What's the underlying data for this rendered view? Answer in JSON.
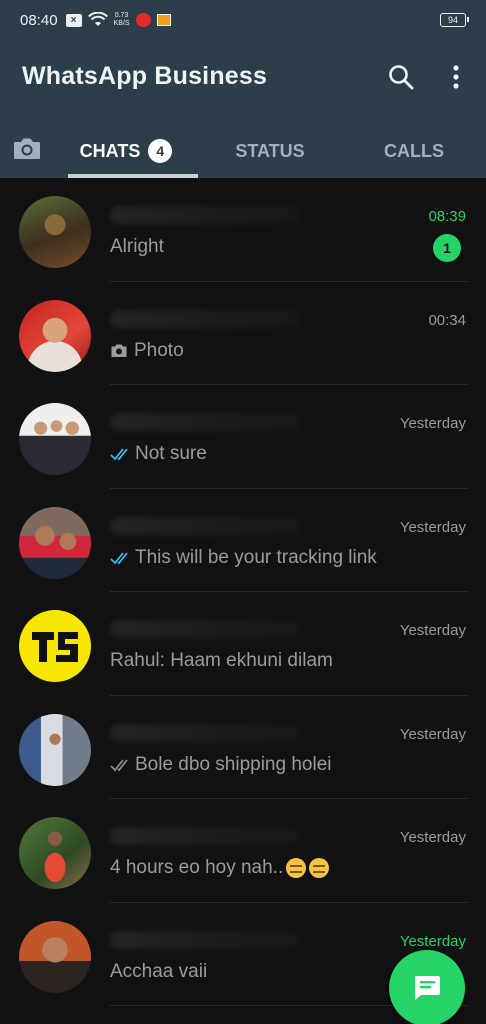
{
  "status_bar": {
    "time": "08:40",
    "speed_value": "0.73",
    "speed_unit": "KB/S",
    "battery": "94"
  },
  "app": {
    "title": "WhatsApp Business"
  },
  "tabs": [
    {
      "label": "CHATS",
      "badge": "4",
      "active": true
    },
    {
      "label": "STATUS",
      "active": false
    },
    {
      "label": "CALLS",
      "active": false
    }
  ],
  "colors": {
    "header": "#2b3e4a",
    "accent": "#25d366",
    "background": "#121212"
  },
  "chats": [
    {
      "time": "08:39",
      "preview": "Alright",
      "unread": "1",
      "time_color": "green",
      "prefix": "none"
    },
    {
      "time": "00:34",
      "preview": "Photo",
      "prefix": "camera-icon"
    },
    {
      "time": "Yesterday",
      "preview": "Not sure",
      "prefix": "double-tick-blue"
    },
    {
      "time": "Yesterday",
      "preview": "This will be your tracking link",
      "prefix": "double-tick-blue"
    },
    {
      "time": "Yesterday",
      "preview": "Rahul: Haam ekhuni dilam",
      "prefix": "none"
    },
    {
      "time": "Yesterday",
      "preview": "Bole dbo shipping holei",
      "prefix": "double-tick-grey"
    },
    {
      "time": "Yesterday",
      "preview": "4 hours eo hoy nah..",
      "prefix": "none"
    },
    {
      "time": "Yesterday",
      "preview": "Acchaa vaii",
      "time_color": "green",
      "prefix": "none"
    }
  ]
}
